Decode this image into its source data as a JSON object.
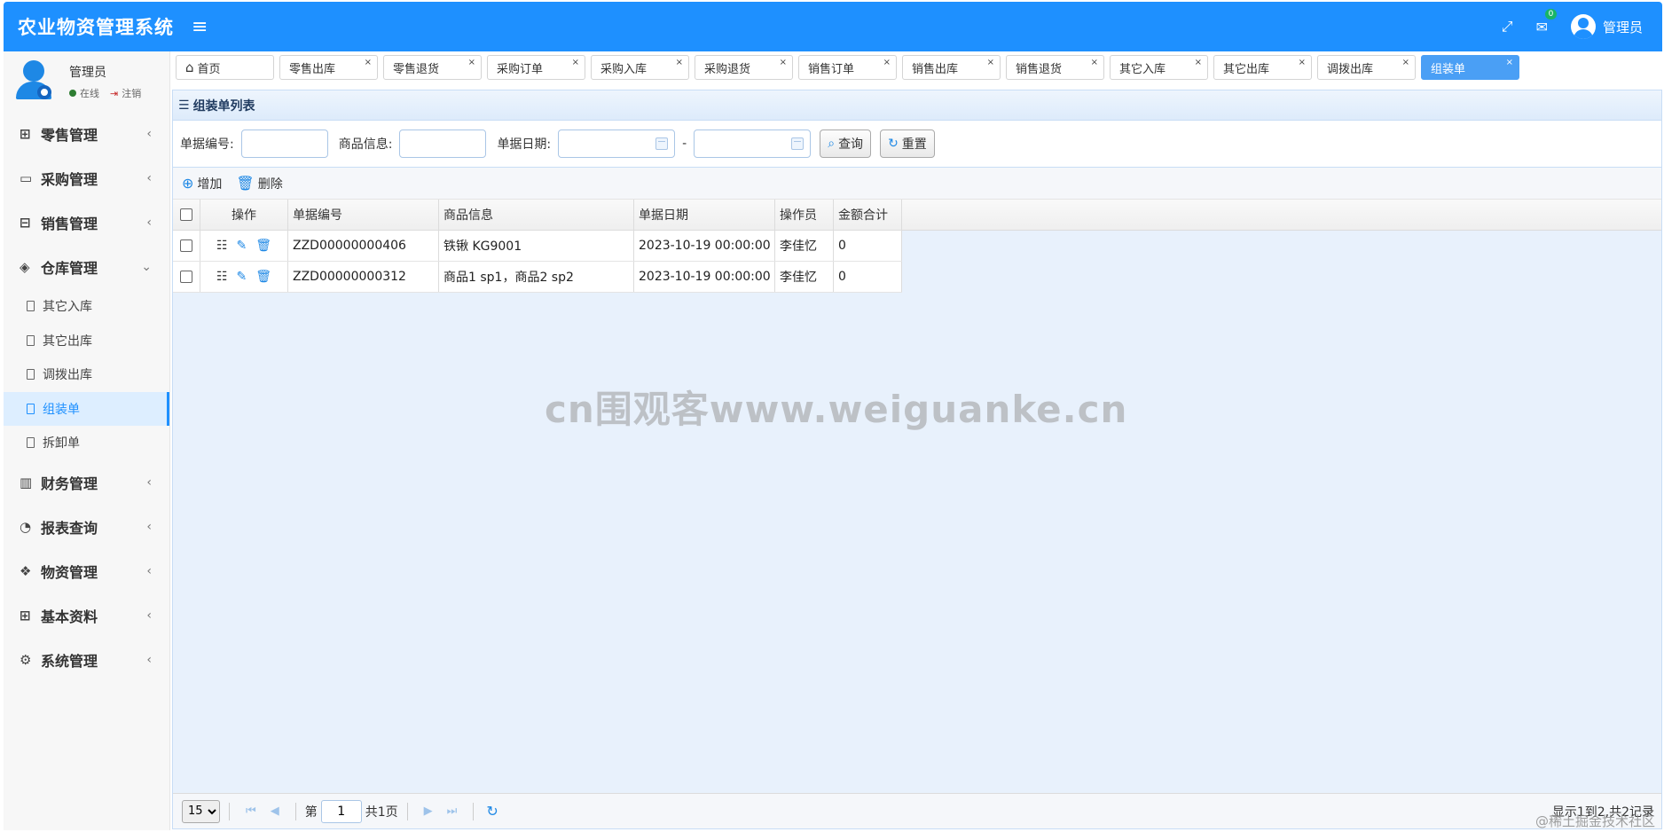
{
  "header": {
    "title": "农业物资管理系统",
    "mail_count": "0",
    "user_name": "管理员"
  },
  "user_panel": {
    "name": "管理员",
    "status": "在线",
    "logout": "注销"
  },
  "sidebar": {
    "groups": [
      {
        "label": "零售管理"
      },
      {
        "label": "采购管理"
      },
      {
        "label": "销售管理"
      },
      {
        "label": "仓库管理"
      },
      {
        "label": "财务管理"
      },
      {
        "label": "报表查询"
      },
      {
        "label": "物资管理"
      },
      {
        "label": "基本资料"
      },
      {
        "label": "系统管理"
      }
    ],
    "warehouse_items": [
      "其它入库",
      "其它出库",
      "调拨出库",
      "组装单",
      "拆卸单"
    ]
  },
  "tabs": [
    "首页",
    "零售出库",
    "零售退货",
    "采购订单",
    "采购入库",
    "采购退货",
    "销售订单",
    "销售出库",
    "销售退货",
    "其它入库",
    "其它出库",
    "调拨出库",
    "组装单"
  ],
  "panel": {
    "title": "组装单列表"
  },
  "search": {
    "code_label": "单据编号:",
    "goods_label": "商品信息:",
    "date_label": "单据日期:",
    "date_sep": "-",
    "query_btn": "查询",
    "reset_btn": "重置"
  },
  "toolbar": {
    "add": "增加",
    "delete": "删除"
  },
  "table": {
    "columns": [
      "操作",
      "单据编号",
      "商品信息",
      "单据日期",
      "操作员",
      "金额合计"
    ],
    "rows": [
      {
        "code": "ZZD00000000406",
        "goods": "铁锹 KG9001",
        "date": "2023-10-19 00:00:00",
        "operator": "李佳忆",
        "amount": "0"
      },
      {
        "code": "ZZD00000000312",
        "goods": "商品1 sp1，商品2 sp2",
        "date": "2023-10-19 00:00:00",
        "operator": "李佳忆",
        "amount": "0"
      }
    ]
  },
  "pager": {
    "page_size": "15",
    "page_prefix": "第",
    "page_value": "1",
    "page_total": "共1页",
    "info": "显示1到2,共2记录"
  },
  "watermark": "cn围观客www.weiguanke.cn",
  "corner_mark": "@稀土掘金技术社区"
}
